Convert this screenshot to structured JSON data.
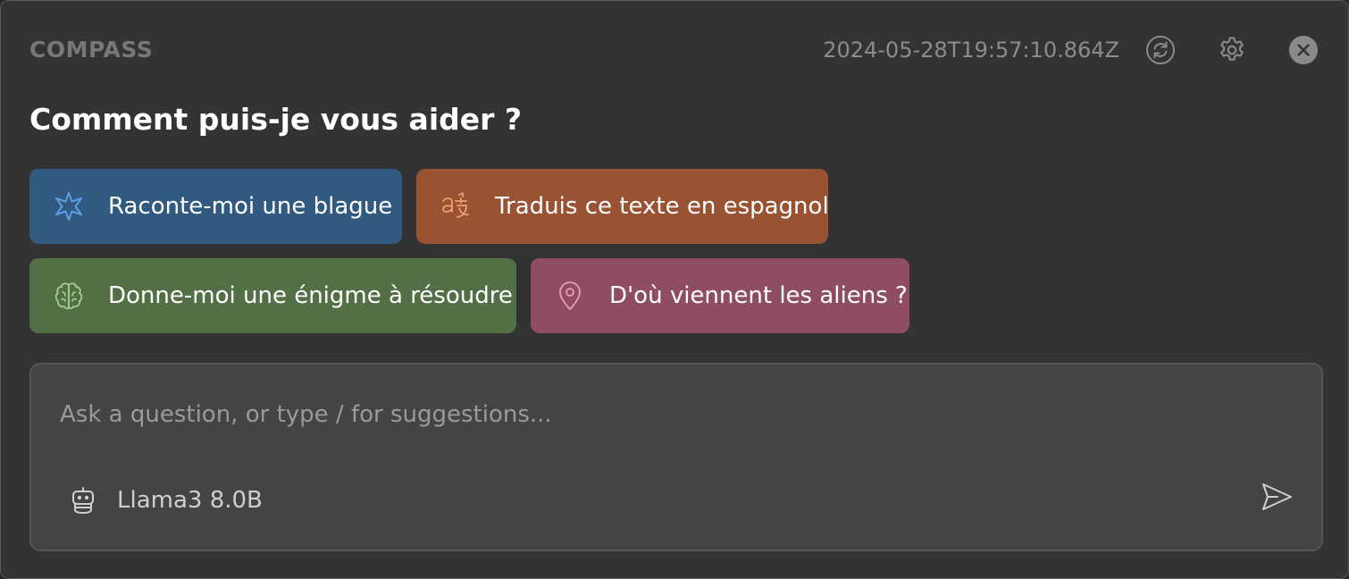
{
  "header": {
    "brand": "COMPASS",
    "timestamp": "2024-05-28T19:57:10.864Z",
    "icons": [
      "refresh-icon",
      "gear-icon",
      "close-icon"
    ]
  },
  "greeting": "Comment puis-je vous aider ?",
  "suggestions": [
    {
      "label": "Raconte-moi une blague",
      "icon": "sparkle-icon",
      "color": "#305a80",
      "icon_color": "#5aa0e6"
    },
    {
      "label": "Traduis ce texte en espagnol",
      "icon": "translate-icon",
      "color": "#9a5332",
      "icon_color": "#f0a070"
    },
    {
      "label": "Donne-moi une énigme à résoudre",
      "icon": "brain-icon",
      "color": "#536f45",
      "icon_color": "#9fd08a"
    },
    {
      "label": "D'où viennent les aliens ?",
      "icon": "location-pin-icon",
      "color": "#8e4d63",
      "icon_color": "#f09ab8"
    }
  ],
  "composer": {
    "placeholder": "Ask a question, or type / for suggestions...",
    "value": "",
    "model": "Llama3 8.0B"
  }
}
